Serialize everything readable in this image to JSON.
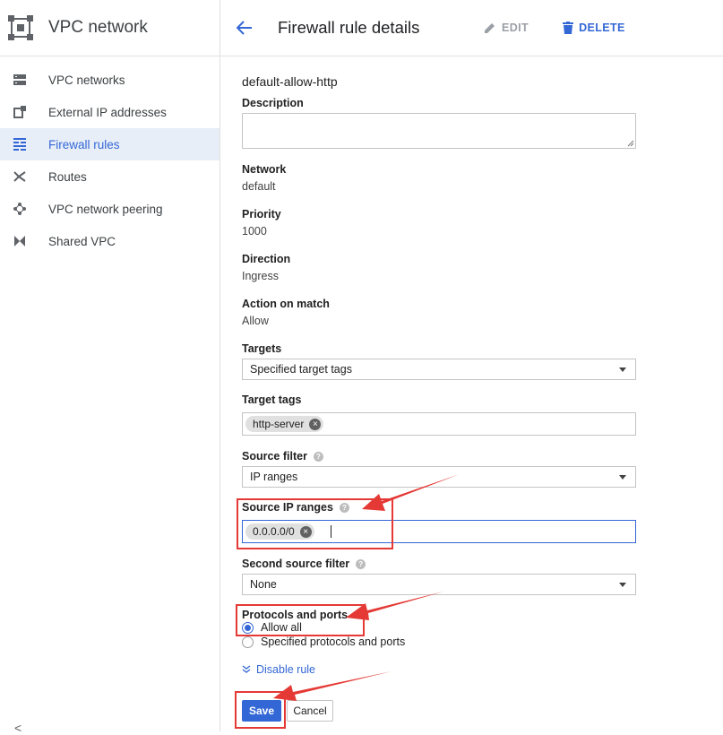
{
  "sidebar": {
    "title": "VPC network",
    "items": [
      {
        "label": "VPC networks"
      },
      {
        "label": "External IP addresses"
      },
      {
        "label": "Firewall rules"
      },
      {
        "label": "Routes"
      },
      {
        "label": "VPC network peering"
      },
      {
        "label": "Shared VPC"
      }
    ],
    "collapse_glyph": "<"
  },
  "header": {
    "title": "Firewall rule details",
    "edit_label": "EDIT",
    "delete_label": "DELETE"
  },
  "rule": {
    "name": "default-allow-http",
    "description_label": "Description",
    "network_label": "Network",
    "network_value": "default",
    "priority_label": "Priority",
    "priority_value": "1000",
    "direction_label": "Direction",
    "direction_value": "Ingress",
    "action_label": "Action on match",
    "action_value": "Allow",
    "targets_label": "Targets",
    "targets_value": "Specified target tags",
    "target_tags_label": "Target tags",
    "target_tag_chip": "http-server",
    "source_filter_label": "Source filter",
    "source_filter_value": "IP ranges",
    "source_ip_label": "Source IP ranges",
    "source_ip_chip": "0.0.0.0/0",
    "second_source_label": "Second source filter",
    "second_source_value": "None",
    "protocols_label": "Protocols and ports",
    "radio_allow_all": "Allow all",
    "radio_specified": "Specified protocols and ports",
    "disable_rule_link": "Disable rule"
  },
  "actions": {
    "save_label": "Save",
    "cancel_label": "Cancel"
  },
  "colors": {
    "accent": "#3367d6",
    "annotation": "#e53935"
  }
}
